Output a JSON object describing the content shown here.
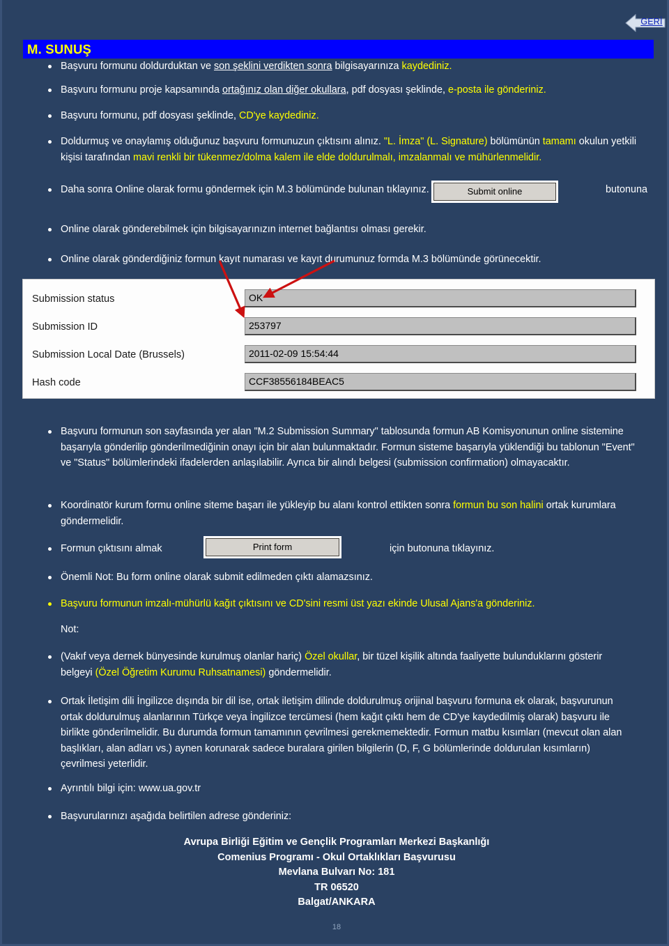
{
  "colors": {
    "background": "#2a4162",
    "title_bar_bg": "#0000FF",
    "title_bar_text": "#FFFF00",
    "body_text": "#FFFFFF",
    "highlight_text": "#FFFF00",
    "arrow": "#CC1111",
    "button_face": "#D6D3CE",
    "field_face": "#C0C0C0",
    "panel_bg": "#FDFDFD",
    "link_text": "#0B21B5"
  },
  "back_button": {
    "label": "GERİ",
    "icon": "left-arrow-icon"
  },
  "title": "M. SUNUŞ",
  "bullets_top": [
    {
      "id": "b1",
      "runs": [
        {
          "text": "Başvuru formunu doldurduktan ve ",
          "style": "plain"
        },
        {
          "text": "son şeklini verdikten sonra",
          "style": "underline"
        },
        {
          "text": " bilgisayarınıza ",
          "style": "plain"
        },
        {
          "text": "kaydediniz.",
          "style": "yellow"
        }
      ]
    },
    {
      "id": "b2",
      "runs": [
        {
          "text": "Başvuru formunu proje kapsamında ",
          "style": "plain"
        },
        {
          "text": "ortağınız olan diğer okullara",
          "style": "underline"
        },
        {
          "text": ", pdf dosyası şeklinde, ",
          "style": "plain"
        },
        {
          "text": "e-posta ile gönderiniz.",
          "style": "yellow"
        }
      ]
    },
    {
      "id": "b3",
      "runs": [
        {
          "text": "Başvuru formunu, pdf dosyası şeklinde, ",
          "style": "plain"
        },
        {
          "text": "CD'ye kaydediniz.",
          "style": "yellow"
        }
      ]
    },
    {
      "id": "b4",
      "runs": [
        {
          "text": "Doldurmuş ve onaylamış olduğunuz başvuru formunuzun çıktısını alınız. ",
          "style": "plain"
        },
        {
          "text": "\"L. İmza\" (L. Signature) ",
          "style": "yellow"
        },
        {
          "text": "bölümünün ",
          "style": "plain"
        },
        {
          "text": "tamamı ",
          "style": "yellow"
        },
        {
          "text": "okulun yetkili kişisi tarafından ",
          "style": "plain"
        },
        {
          "text": "mavi renkli bir tükenmez/dolma kalem ile elde doldurulmalı, imzalanmalı ve mühürlenmelidir.",
          "style": "yellow"
        }
      ]
    },
    {
      "id": "b5",
      "runs": [
        {
          "text": "Daha sonra Online olarak formu göndermek için M.3 bölümünde bulunan tıklayınız.",
          "style": "plain"
        }
      ]
    },
    {
      "id": "b6",
      "runs": [
        {
          "text": "Online olarak gönderebilmek için bilgisayarınızın internet bağlantısı olması gerekir.",
          "style": "plain"
        }
      ]
    },
    {
      "id": "b7",
      "runs": [
        {
          "text": "Online olarak gönderdiğiniz formun kayıt numarası ve kayıt durumunuz formda M.3 bölümünde görünecektir.",
          "style": "plain"
        }
      ]
    }
  ],
  "submit_online_button": "Submit online",
  "submit_online_trailing_word": "butonuna",
  "submission_panel": {
    "rows": [
      {
        "label": "Submission status",
        "value": "OK"
      },
      {
        "label": "Submission ID",
        "value": "253797"
      },
      {
        "label": "Submission Local Date (Brussels)",
        "value": "2011-02-09 15:54:44"
      },
      {
        "label": "Hash code",
        "value": "CCF38556184BEAC5"
      }
    ]
  },
  "bullets_bottom": [
    {
      "id": "lb1",
      "runs": [
        {
          "text": "   Başvuru formunun son sayfasında yer alan \"M.2 Submission Summary\" tablosunda formun AB Komisyonunun online sistemine başarıyla gönderilip gönderilmediğinin onayı için bir alan bulunmaktadır. Formun sisteme başarıyla yüklendiği bu tablonun \"Event\" ve \"Status\" bölümlerindeki ifadelerden anlaşılabilir. Ayrıca bir alındı belgesi (submission confirmation) olmayacaktır.",
          "style": "plain"
        }
      ]
    },
    {
      "id": "lb2",
      "runs": [
        {
          "text": "   Koordinatör kurum formu online siteme başarı ile yükleyip bu alanı kontrol ettikten sonra ",
          "style": "plain"
        },
        {
          "text": "formun bu son halini",
          "style": "yellow"
        },
        {
          "text": " ortak kurumlara göndermelidir.",
          "style": "plain"
        }
      ]
    },
    {
      "id": "lb3",
      "runs": [
        {
          "text": "   Formun çıktısını almak",
          "style": "plain"
        }
      ]
    },
    {
      "id": "lb4",
      "runs": [
        {
          "text": "Önemli Not: Bu form online olarak submit edilmeden çıktı alamazsınız.",
          "style": "plain"
        }
      ]
    },
    {
      "id": "lb5",
      "runs": [
        {
          "text": "Başvuru formunun imzalı-mühürlü kağıt çıktısını ve CD'sini resmi üst yazı ekinde Ulusal Ajans'a gönderiniz.",
          "style": "yellow"
        }
      ]
    },
    {
      "id": "lb6",
      "runs": [
        {
          "text": " (Vakıf veya dernek bünyesinde kurulmuş olanlar hariç) ",
          "style": "plain"
        },
        {
          "text": "Özel okullar",
          "style": "yellow"
        },
        {
          "text": ", bir tüzel kişilik altında faaliyette bulunduklarını gösterir belgeyi ",
          "style": "plain"
        },
        {
          "text": "(Özel Öğretim Kurumu Ruhsatnamesi)",
          "style": "yellow"
        },
        {
          "text": " göndermelidir.",
          "style": "plain"
        }
      ]
    },
    {
      "id": "lb7",
      "runs": [
        {
          "text": "Ortak İletişim dili İngilizce dışında bir dil ise, ortak iletişim dilinde doldurulmuş orijinal başvuru formuna ek olarak, başvurunun ortak doldurulmuş alanlarının Türkçe veya İngilizce tercümesi (hem kağıt çıktı hem de CD'ye kaydedilmiş olarak) başvuru ile birlikte gönderilmelidir. Bu durumda formun tamamının çevrilmesi gerekmemektedir. Formun matbu kısımları (mevcut olan alan başlıkları, alan adları vs.) aynen korunarak sadece buralara girilen bilgilerin (D, F, G bölümlerinde doldurulan kısımların) çevrilmesi yeterlidir.",
          "style": "plain"
        }
      ]
    },
    {
      "id": "lb8",
      "runs": [
        {
          "text": "Ayrıntılı bilgi için: www.ua.gov.tr",
          "style": "plain"
        }
      ]
    },
    {
      "id": "lb9",
      "runs": [
        {
          "text": "Başvurularınızı aşağıda belirtilen adrese gönderiniz:",
          "style": "plain"
        }
      ]
    }
  ],
  "print_form_button": "Print form",
  "print_form_trailing": "için butonuna tıklayınız.",
  "note_label": "Not:",
  "address": [
    "Avrupa Birliği Eğitim ve Gençlik Programları Merkezi Başkanlığı",
    "Comenius Programı - Okul Ortaklıkları Başvurusu",
    "Mevlana Bulvarı No: 181",
    "TR 06520",
    "Balgat/ANKARA"
  ],
  "page_number": "18"
}
